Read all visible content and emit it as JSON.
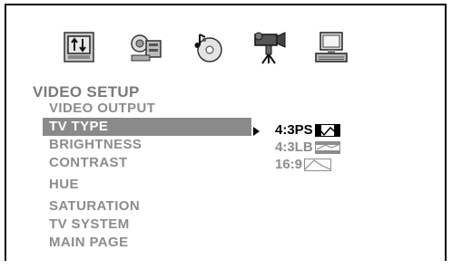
{
  "icons": [
    {
      "name": "general-setup-icon",
      "selected": false
    },
    {
      "name": "speaker-setup-icon",
      "selected": false
    },
    {
      "name": "audio-setup-icon",
      "selected": false
    },
    {
      "name": "video-camera-icon",
      "selected": true
    },
    {
      "name": "preference-computer-icon",
      "selected": false
    }
  ],
  "menu": {
    "title": "VIDEO SETUP",
    "items": [
      {
        "label": "VIDEO OUTPUT"
      },
      {
        "label": "TV TYPE"
      },
      {
        "label": "BRIGHTNESS"
      },
      {
        "label": "CONTRAST"
      },
      {
        "label": "HUE"
      },
      {
        "label": "SATURATION"
      },
      {
        "label": "TV SYSTEM"
      },
      {
        "label": "MAIN PAGE"
      }
    ],
    "selected_item": "TV TYPE"
  },
  "options": {
    "items": [
      {
        "label": "4:3PS",
        "thumb": "pan-scan-thumb-icon"
      },
      {
        "label": "4:3LB",
        "thumb": "letterbox-thumb-icon"
      },
      {
        "label": "16:9",
        "thumb": "widescreen-thumb-icon"
      }
    ],
    "active": "4:3PS"
  },
  "colors": {
    "highlight": "#8a8a8a",
    "menu_text": "#8c8c8c",
    "title_text": "#7a7a7a"
  }
}
